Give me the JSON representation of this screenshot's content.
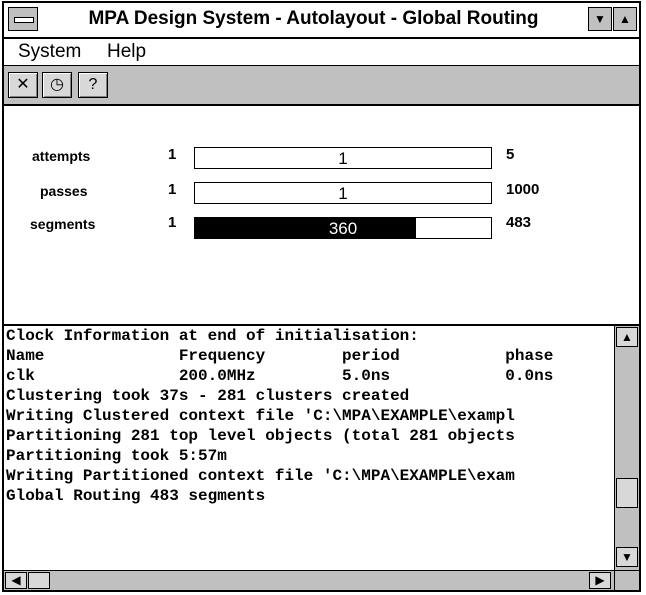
{
  "window": {
    "title": "MPA Design System - Autolayout - Global Routing"
  },
  "menu": {
    "items": [
      {
        "label": "System",
        "accel": "S"
      },
      {
        "label": "Help",
        "accel": "H"
      }
    ]
  },
  "toolbar": {
    "tools": [
      {
        "icon": "close-x-icon",
        "glyph": "✕"
      },
      {
        "icon": "clock-icon",
        "glyph": "◷"
      },
      {
        "icon": "help-question-icon",
        "glyph": "?"
      }
    ]
  },
  "progress": [
    {
      "label": "attempts",
      "min": "1",
      "value": "1",
      "max": "5",
      "fraction": 0
    },
    {
      "label": "passes",
      "min": "1",
      "value": "1",
      "max": "1000",
      "fraction": 0
    },
    {
      "label": "segments",
      "min": "1",
      "value": "360",
      "max": "483",
      "fraction": 0.745
    }
  ],
  "log": {
    "lines": [
      "Clock Information at end of initialisation:",
      "Name              Frequency        period           phase",
      "clk               200.0MHz         5.0ns            0.0ns",
      "Clustering took 37s - 281 clusters created",
      "Writing Clustered context file 'C:\\MPA\\EXAMPLE\\exampl",
      "Partitioning 281 top level objects (total 281 objects",
      "Partitioning took 5:57m",
      "Writing Partitioned context file 'C:\\MPA\\EXAMPLE\\exam",
      "Global Routing 483 segments"
    ]
  },
  "scroll": {
    "up": "▲",
    "down": "▼",
    "left": "◀",
    "right": "▶"
  },
  "titlebar": {
    "minimize": "▼",
    "maximize": "▲"
  }
}
